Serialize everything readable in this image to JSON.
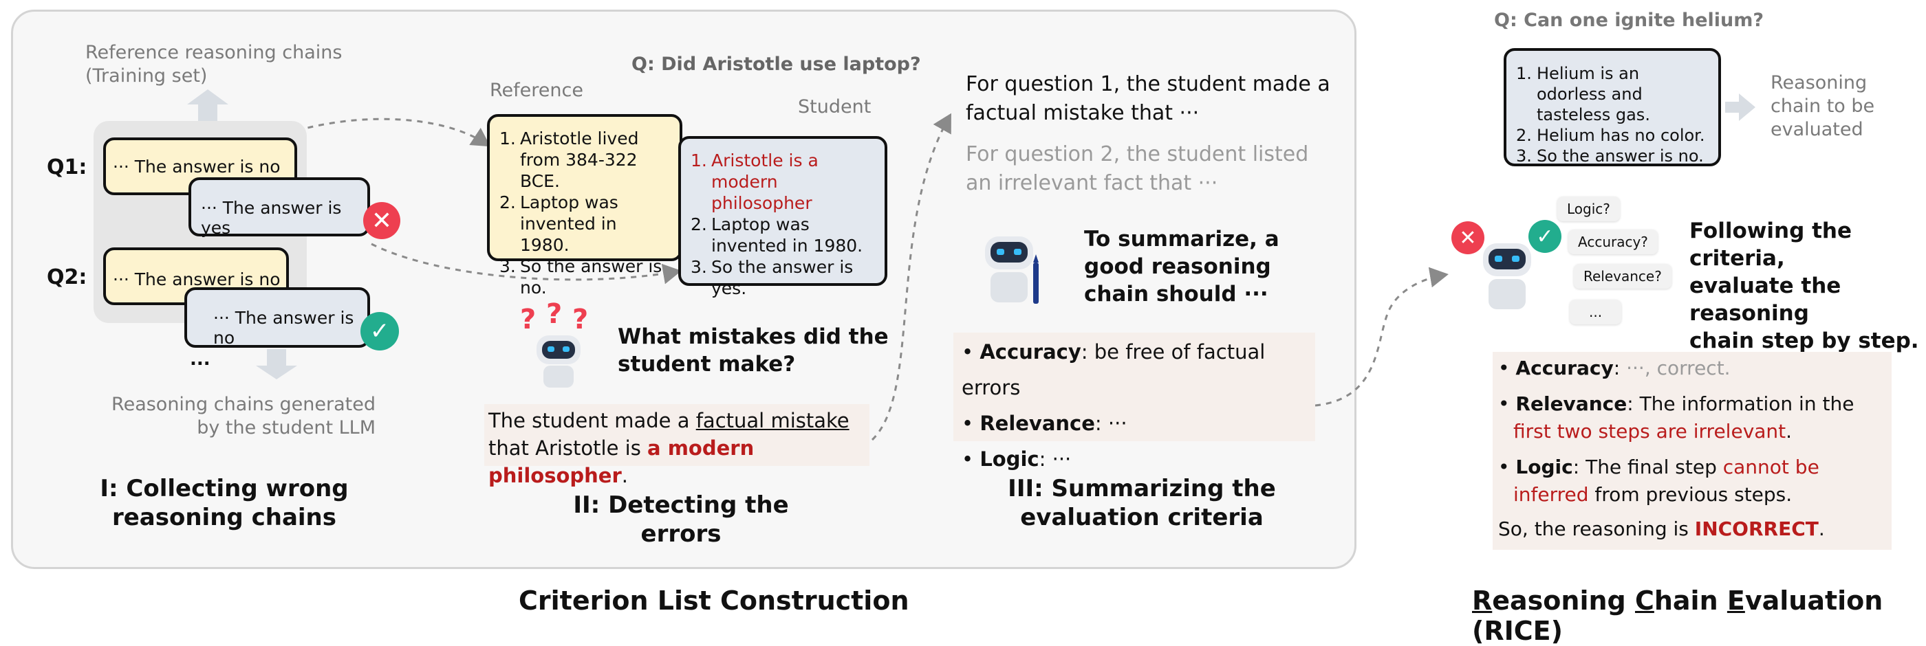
{
  "panel1": {
    "ref_title_line1": "Reference reasoning chains",
    "ref_title_line2": "(Training set)",
    "q1_label": "Q1:",
    "q2_label": "Q2:",
    "q1_ref": "··· The answer is no",
    "q1_student": "··· The answer is yes",
    "q2_ref": "··· The answer is no",
    "q2_student": "··· The answer is no",
    "ellipsis": "...",
    "gen_line1": "Reasoning chains generated",
    "gen_line2": "by the student LLM",
    "caption_line1": "I: Collecting wrong",
    "caption_line2": "reasoning chains"
  },
  "panel2": {
    "question": "Q: Did Aristotle use laptop?",
    "reference_label": "Reference",
    "student_label": "Student",
    "reference_steps": [
      {
        "n": "1.",
        "text": "Aristotle lived from 384-322 BCE."
      },
      {
        "n": "2.",
        "text": "Laptop was invented in 1980."
      },
      {
        "n": "3.",
        "text": "So the answer is no."
      }
    ],
    "student_steps": [
      {
        "n": "1.",
        "text": "Aristotle is a modern philosopher"
      },
      {
        "n": "2.",
        "text": "Laptop was invented in 1980."
      },
      {
        "n": "3.",
        "text": "So the answer is yes."
      }
    ],
    "prompt_line1": "What mistakes did the",
    "prompt_line2": "student make?",
    "answer_part1": "The student made a ",
    "answer_underlined": "factual mistake",
    "answer_part2": "that Aristotle is ",
    "answer_red": "a modern philosopher",
    "answer_end": ".",
    "caption": "II: Detecting the errors"
  },
  "panel3": {
    "q1_line1": "For question 1, the student made a",
    "q1_line2": "factual mistake that ···",
    "q2_line1": "For question 2, the student listed",
    "q2_line2": "an irrelevant fact that ···",
    "summ_line1": "To summarize, a",
    "summ_line2": "good reasoning",
    "summ_line3": "chain should ···",
    "criteria": [
      {
        "name": "Accuracy",
        "desc": ": be free of factual errors"
      },
      {
        "name": "Relevance",
        "desc": ": ···"
      },
      {
        "name": "Logic",
        "desc": ": ···"
      }
    ],
    "caption_line1": "III: Summarizing the",
    "caption_line2": "evaluation criteria"
  },
  "panel4": {
    "question": "Q: Can one ignite helium?",
    "steps": [
      {
        "n": "1.",
        "text": "Helium is an odorless and tasteless gas."
      },
      {
        "n": "2.",
        "text": "Helium has no color."
      },
      {
        "n": "3.",
        "text": "So the answer is no."
      }
    ],
    "chain_label_line1": "Reasoning",
    "chain_label_line2": "chain to be",
    "chain_label_line3": "evaluated",
    "bubbles": [
      "Logic?",
      "Accuracy?",
      "Relevance?",
      "..."
    ],
    "follow_line1": "Following the criteria,",
    "follow_line2": "evaluate the reasoning",
    "follow_line3": "chain step by step.",
    "eval_accuracy_name": "Accuracy",
    "eval_accuracy_colon": ": ",
    "eval_accuracy_gray": "···, correct.",
    "eval_relevance_name": "Relevance",
    "eval_relevance_text": ": The information in the",
    "eval_relevance_red": "first two steps are irrelevant",
    "eval_relevance_end": ".",
    "eval_logic_name": "Logic",
    "eval_logic_text": ": The final step ",
    "eval_logic_red1": "cannot be",
    "eval_logic_red2": "inferred",
    "eval_logic_end": " from previous steps.",
    "verdict_prefix": "So, the reasoning is ",
    "verdict_red": "INCORRECT",
    "verdict_end": "."
  },
  "bottom": {
    "left_title": "Criterion List Construction",
    "right_R": "R",
    "right_part1": "easoning ",
    "right_C": "C",
    "right_part2": "hain ",
    "right_E": "E",
    "right_part3": "valuation (RICE)"
  },
  "colors": {
    "accent_red": "#b91c1c",
    "cross_red": "#ee3f50",
    "check_green": "#22ad8e",
    "card_yellow": "#fdf3cf",
    "card_blue": "#e3e8ef",
    "highlight_pink": "#f6efeb"
  }
}
